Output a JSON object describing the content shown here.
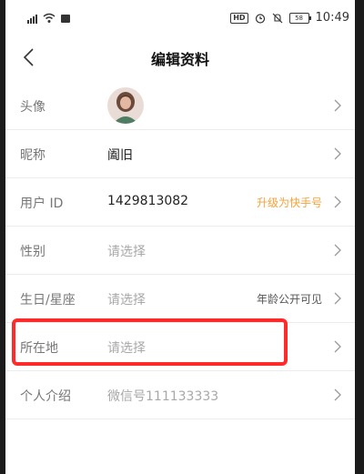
{
  "statusbar": {
    "time": "10:49",
    "hd": "HD",
    "battery": "58"
  },
  "header": {
    "title": "编辑资料"
  },
  "rows": [
    {
      "label": "头像",
      "value": "",
      "right": ""
    },
    {
      "label": "昵称",
      "value": "阖旧",
      "right": ""
    },
    {
      "label": "用户 ID",
      "value": "1429813082",
      "right": "升级为快手号"
    },
    {
      "label": "性别",
      "value": "请选择",
      "right": ""
    },
    {
      "label": "生日/星座",
      "value": "请选择",
      "right": "年龄公开可见"
    },
    {
      "label": "所在地",
      "value": "请选择",
      "right": ""
    },
    {
      "label": "个人介绍",
      "value": "微信号111133333",
      "right": ""
    }
  ],
  "colors": {
    "accent_orange": "#f2a23a",
    "highlight_red": "#ff2b2b"
  },
  "icons": [
    "back-arrow-icon",
    "chevron-right-icon",
    "signal-icon",
    "wifi-icon",
    "alarm-icon",
    "mute-icon",
    "battery-icon"
  ]
}
